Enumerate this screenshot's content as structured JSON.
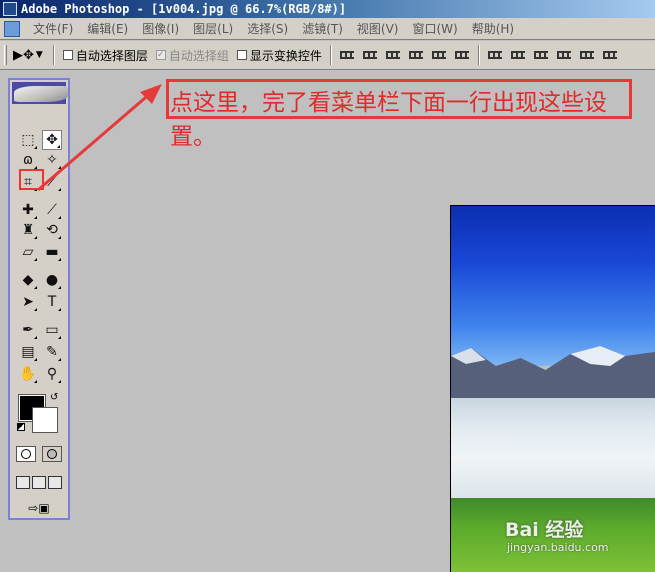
{
  "titlebar": {
    "title": "Adobe Photoshop - [1v004.jpg @ 66.7%(RGB/8#)]"
  },
  "menubar": {
    "items": [
      {
        "label": "文件(F)"
      },
      {
        "label": "编辑(E)"
      },
      {
        "label": "图像(I)"
      },
      {
        "label": "图层(L)"
      },
      {
        "label": "选择(S)"
      },
      {
        "label": "滤镜(T)"
      },
      {
        "label": "视图(V)"
      },
      {
        "label": "窗口(W)"
      },
      {
        "label": "帮助(H)"
      }
    ]
  },
  "options": {
    "tool_preset_icon": "move-tool-icon",
    "auto_select_layer": {
      "label": "自动选择图层",
      "checked": false
    },
    "auto_select_group": {
      "label": "自动选择组",
      "checked": true,
      "disabled": true
    },
    "show_transform": {
      "label": "显示变换控件",
      "checked": false
    }
  },
  "toolbox": {
    "tools": [
      {
        "name": "rect-marquee-icon",
        "glyph": "⬚"
      },
      {
        "name": "move-icon",
        "glyph": "✥"
      },
      {
        "name": "lasso-icon",
        "glyph": "ɷ"
      },
      {
        "name": "magic-wand-icon",
        "glyph": "✧"
      },
      {
        "name": "crop-icon",
        "glyph": "⌗"
      },
      {
        "name": "slice-icon",
        "glyph": "⟋"
      },
      {
        "name": "healing-brush-icon",
        "glyph": "✚"
      },
      {
        "name": "brush-icon",
        "glyph": "⟋"
      },
      {
        "name": "clone-stamp-icon",
        "glyph": "♜"
      },
      {
        "name": "history-brush-icon",
        "glyph": "⟲"
      },
      {
        "name": "eraser-icon",
        "glyph": "▱"
      },
      {
        "name": "gradient-icon",
        "glyph": "▬"
      },
      {
        "name": "blur-icon",
        "glyph": "◆"
      },
      {
        "name": "dodge-icon",
        "glyph": "●"
      },
      {
        "name": "path-select-icon",
        "glyph": "➤"
      },
      {
        "name": "type-icon",
        "glyph": "T"
      },
      {
        "name": "pen-icon",
        "glyph": "✒"
      },
      {
        "name": "shape-icon",
        "glyph": "▭"
      },
      {
        "name": "notes-icon",
        "glyph": "▤"
      },
      {
        "name": "eyedropper-icon",
        "glyph": "✎"
      },
      {
        "name": "hand-icon",
        "glyph": "✋"
      },
      {
        "name": "zoom-icon",
        "glyph": "⚲"
      }
    ],
    "foreground_color": "#000000",
    "background_color": "#ffffff",
    "jump_glyph": "⇨▣"
  },
  "annotation": {
    "text": "点这里，完了看菜单栏下面一行出现这些设置。",
    "color": "#e12a2a"
  },
  "watermark": {
    "logo": "Bai 经验",
    "url": "jingyan.baidu.com"
  }
}
